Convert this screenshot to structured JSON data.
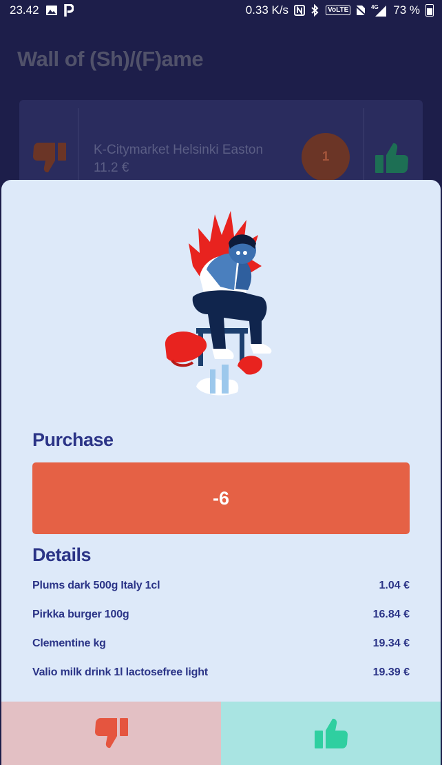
{
  "status_bar": {
    "time": "23.42",
    "net_speed": "0.33 K/s",
    "volte": "VoLTE",
    "network": "4G",
    "battery": "73 %"
  },
  "app": {
    "title": "Wall of (Sh)/(F)ame"
  },
  "store_card": {
    "name": "K-Citymarket Helsinki Easton",
    "amount": "11.2 €",
    "rank": "1"
  },
  "sheet": {
    "purchase_label": "Purchase",
    "purchase_value": "-6",
    "details_label": "Details",
    "items": [
      {
        "name": "Plums dark 500g Italy 1cl",
        "price": "1.04 €"
      },
      {
        "name": "Pirkka burger 100g",
        "price": "16.84 €"
      },
      {
        "name": "Clementine kg",
        "price": "19.34 €"
      },
      {
        "name": "Valio milk drink 1l lactosefree light",
        "price": "19.39 €"
      }
    ]
  },
  "colors": {
    "accent_red": "#e56145",
    "accent_green": "#2fcfa0",
    "text_primary": "#2b3487",
    "sheet_bg": "#dde9f9"
  },
  "icons": {
    "thumbs_down": "thumbs-down-icon",
    "thumbs_up": "thumbs-up-icon"
  }
}
